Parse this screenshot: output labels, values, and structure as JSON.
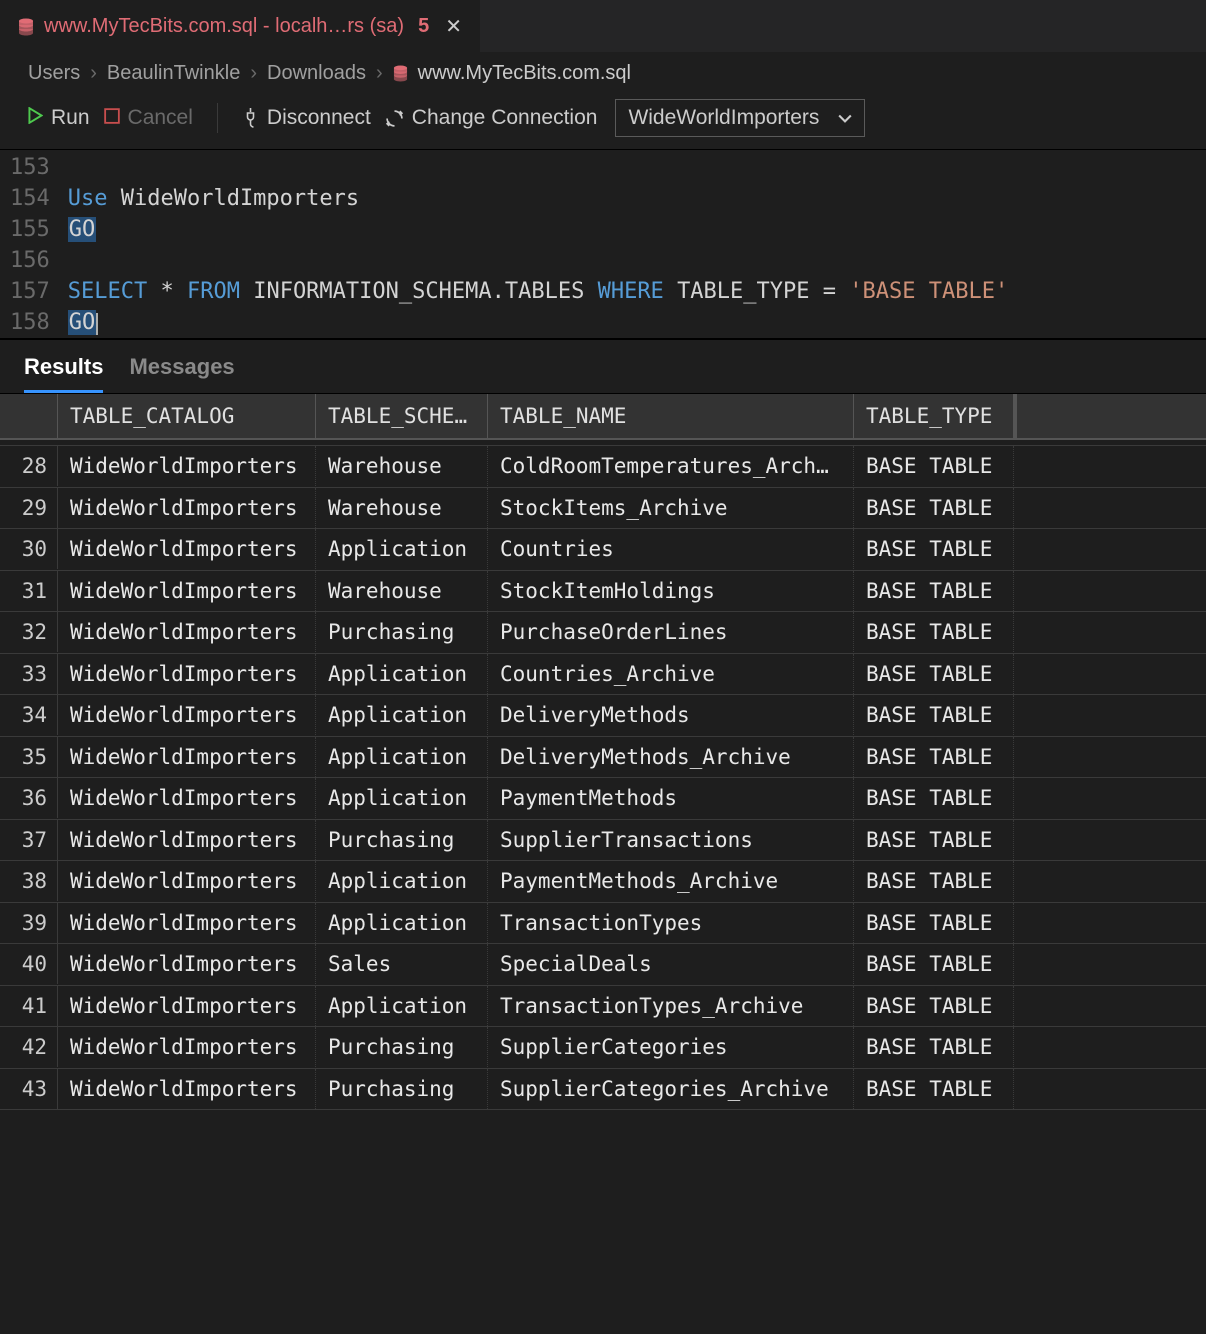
{
  "tab": {
    "title": "www.MyTecBits.com.sql - localh…rs (sa)",
    "dirtyMark": "5",
    "closeGlyph": "✕"
  },
  "breadcrumb": {
    "items": [
      "Users",
      "BeaulinTwinkle",
      "Downloads"
    ],
    "file": "www.MyTecBits.com.sql",
    "sep": "›"
  },
  "toolbar": {
    "run": "Run",
    "cancel": "Cancel",
    "disconnect": "Disconnect",
    "changeConnection": "Change Connection",
    "database": "WideWorldImporters"
  },
  "editor": {
    "lines": [
      {
        "num": "153",
        "tokens": []
      },
      {
        "num": "154",
        "tokens": [
          {
            "t": "Use ",
            "c": "kw"
          },
          {
            "t": "WideWorldImporters",
            "c": "ident"
          }
        ]
      },
      {
        "num": "155",
        "tokens": [
          {
            "t": "GO",
            "c": "hlgo"
          }
        ]
      },
      {
        "num": "156",
        "tokens": []
      },
      {
        "num": "157",
        "tokens": [
          {
            "t": "SELECT ",
            "c": "kw"
          },
          {
            "t": "* ",
            "c": "ident"
          },
          {
            "t": "FROM ",
            "c": "kw"
          },
          {
            "t": "INFORMATION_SCHEMA.TABLES ",
            "c": "ident"
          },
          {
            "t": "WHERE ",
            "c": "kw"
          },
          {
            "t": "TABLE_TYPE ",
            "c": "ident"
          },
          {
            "t": "= ",
            "c": "ident"
          },
          {
            "t": "'BASE TABLE'",
            "c": "str"
          }
        ]
      },
      {
        "num": "158",
        "tokens": [
          {
            "t": "GO",
            "c": "hlgo"
          }
        ],
        "cursor": true
      }
    ]
  },
  "resultTabs": {
    "results": "Results",
    "messages": "Messages"
  },
  "grid": {
    "columns": [
      "TABLE_CATALOG",
      "TABLE_SCHEMA",
      "TABLE_NAME",
      "TABLE_TYPE"
    ],
    "rows": [
      {
        "n": "28",
        "c": [
          "WideWorldImporters",
          "Warehouse",
          "ColdRoomTemperatures_Arch…",
          "BASE TABLE"
        ]
      },
      {
        "n": "29",
        "c": [
          "WideWorldImporters",
          "Warehouse",
          "StockItems_Archive",
          "BASE TABLE"
        ]
      },
      {
        "n": "30",
        "c": [
          "WideWorldImporters",
          "Application",
          "Countries",
          "BASE TABLE"
        ]
      },
      {
        "n": "31",
        "c": [
          "WideWorldImporters",
          "Warehouse",
          "StockItemHoldings",
          "BASE TABLE"
        ]
      },
      {
        "n": "32",
        "c": [
          "WideWorldImporters",
          "Purchasing",
          "PurchaseOrderLines",
          "BASE TABLE"
        ]
      },
      {
        "n": "33",
        "c": [
          "WideWorldImporters",
          "Application",
          "Countries_Archive",
          "BASE TABLE"
        ]
      },
      {
        "n": "34",
        "c": [
          "WideWorldImporters",
          "Application",
          "DeliveryMethods",
          "BASE TABLE"
        ]
      },
      {
        "n": "35",
        "c": [
          "WideWorldImporters",
          "Application",
          "DeliveryMethods_Archive",
          "BASE TABLE"
        ]
      },
      {
        "n": "36",
        "c": [
          "WideWorldImporters",
          "Application",
          "PaymentMethods",
          "BASE TABLE"
        ]
      },
      {
        "n": "37",
        "c": [
          "WideWorldImporters",
          "Purchasing",
          "SupplierTransactions",
          "BASE TABLE"
        ]
      },
      {
        "n": "38",
        "c": [
          "WideWorldImporters",
          "Application",
          "PaymentMethods_Archive",
          "BASE TABLE"
        ]
      },
      {
        "n": "39",
        "c": [
          "WideWorldImporters",
          "Application",
          "TransactionTypes",
          "BASE TABLE"
        ]
      },
      {
        "n": "40",
        "c": [
          "WideWorldImporters",
          "Sales",
          "SpecialDeals",
          "BASE TABLE"
        ]
      },
      {
        "n": "41",
        "c": [
          "WideWorldImporters",
          "Application",
          "TransactionTypes_Archive",
          "BASE TABLE"
        ]
      },
      {
        "n": "42",
        "c": [
          "WideWorldImporters",
          "Purchasing",
          "SupplierCategories",
          "BASE TABLE"
        ]
      },
      {
        "n": "43",
        "c": [
          "WideWorldImporters",
          "Purchasing",
          "SupplierCategories_Archive",
          "BASE TABLE"
        ]
      }
    ]
  }
}
